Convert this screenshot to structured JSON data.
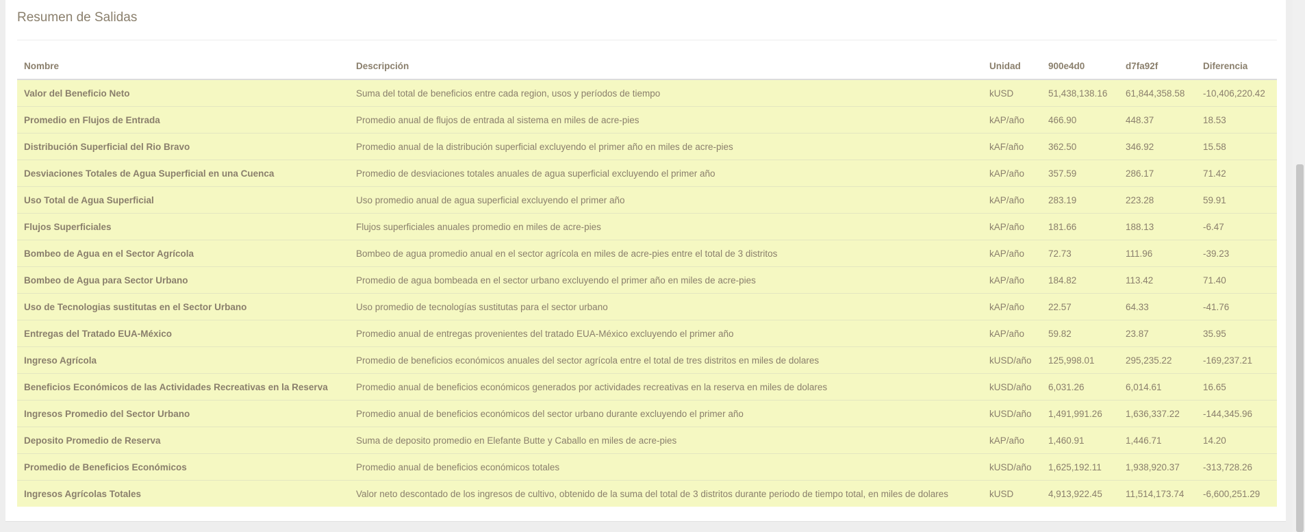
{
  "panel": {
    "title": "Resumen de Salidas"
  },
  "table": {
    "headers": {
      "name": "Nombre",
      "description": "Descripción",
      "unit": "Unidad",
      "run_a": "900e4d0",
      "run_b": "d7fa92f",
      "difference": "Diferencia"
    },
    "rows": [
      {
        "name": "Valor del Beneficio Neto",
        "description": "Suma del total de beneficios entre cada region, usos y períodos de tiempo",
        "unit": "kUSD",
        "run_a": "51,438,138.16",
        "run_b": "61,844,358.58",
        "difference": "-10,406,220.42"
      },
      {
        "name": "Promedio en Flujos de Entrada",
        "description": "Promedio anual de flujos de entrada al sistema en miles de acre-pies",
        "unit": "kAP/año",
        "run_a": "466.90",
        "run_b": "448.37",
        "difference": "18.53"
      },
      {
        "name": "Distribución Superficial del Rio Bravo",
        "description": "Promedio anual de la distribución superficial excluyendo el primer año en miles de acre-pies",
        "unit": "kAF/año",
        "run_a": "362.50",
        "run_b": "346.92",
        "difference": "15.58"
      },
      {
        "name": "Desviaciones Totales de Agua Superficial en una Cuenca",
        "description": "Promedio de desviaciones totales anuales de agua superficial excluyendo el primer año",
        "unit": "kAP/año",
        "run_a": "357.59",
        "run_b": "286.17",
        "difference": "71.42"
      },
      {
        "name": "Uso Total de Agua Superficial",
        "description": "Uso promedio anual de agua superficial excluyendo el primer año",
        "unit": "kAP/año",
        "run_a": "283.19",
        "run_b": "223.28",
        "difference": "59.91"
      },
      {
        "name": "Flujos Superficiales",
        "description": "Flujos superficiales anuales promedio en miles de acre-pies",
        "unit": "kAP/año",
        "run_a": "181.66",
        "run_b": "188.13",
        "difference": "-6.47"
      },
      {
        "name": "Bombeo de Agua en el Sector Agrícola",
        "description": "Bombeo de agua promedio anual en el sector agrícola en miles de acre-pies entre el total de 3 distritos",
        "unit": "kAP/año",
        "run_a": "72.73",
        "run_b": "111.96",
        "difference": "-39.23"
      },
      {
        "name": "Bombeo de Agua para Sector Urbano",
        "description": "Promedio de agua bombeada en el sector urbano excluyendo el primer año en miles de acre-pies",
        "unit": "kAP/año",
        "run_a": "184.82",
        "run_b": "113.42",
        "difference": "71.40"
      },
      {
        "name": "Uso de Tecnologias sustitutas en el Sector Urbano",
        "description": "Uso promedio de tecnologías sustitutas para el sector urbano",
        "unit": "kAP/año",
        "run_a": "22.57",
        "run_b": "64.33",
        "difference": "-41.76"
      },
      {
        "name": "Entregas del Tratado EUA-México",
        "description": "Promedio anual de entregas provenientes del tratado EUA-México excluyendo el primer año",
        "unit": "kAP/año",
        "run_a": "59.82",
        "run_b": "23.87",
        "difference": "35.95"
      },
      {
        "name": "Ingreso Agrícola",
        "description": "Promedio de beneficios económicos anuales del sector agrícola entre el total de tres distritos en miles de dolares",
        "unit": "kUSD/año",
        "run_a": "125,998.01",
        "run_b": "295,235.22",
        "difference": "-169,237.21"
      },
      {
        "name": "Beneficios Económicos de las Actividades Recreativas en la Reserva",
        "description": "Promedio anual de beneficios económicos generados por actividades recreativas en la reserva en miles de dolares",
        "unit": "kUSD/año",
        "run_a": "6,031.26",
        "run_b": "6,014.61",
        "difference": "16.65"
      },
      {
        "name": "Ingresos Promedio del Sector Urbano",
        "description": "Promedio anual de beneficios económicos del sector urbano durante excluyendo el primer año",
        "unit": "kUSD/año",
        "run_a": "1,491,991.26",
        "run_b": "1,636,337.22",
        "difference": "-144,345.96"
      },
      {
        "name": "Deposito Promedio de Reserva",
        "description": "Suma de deposito promedio en Elefante Butte y Caballo en miles de acre-pies",
        "unit": "kAP/año",
        "run_a": "1,460.91",
        "run_b": "1,446.71",
        "difference": "14.20"
      },
      {
        "name": "Promedio de Beneficios Económicos",
        "description": "Promedio anual de beneficios económicos totales",
        "unit": "kUSD/año",
        "run_a": "1,625,192.11",
        "run_b": "1,938,920.37",
        "difference": "-313,728.26"
      },
      {
        "name": "Ingresos Agrícolas Totales",
        "description": "Valor neto descontado de los ingresos de cultivo, obtenido de la suma del total de 3 distritos durante periodo de tiempo total, en miles de dolares",
        "unit": "kUSD",
        "run_a": "4,913,922.45",
        "run_b": "11,514,173.74",
        "difference": "-6,600,251.29"
      }
    ]
  }
}
